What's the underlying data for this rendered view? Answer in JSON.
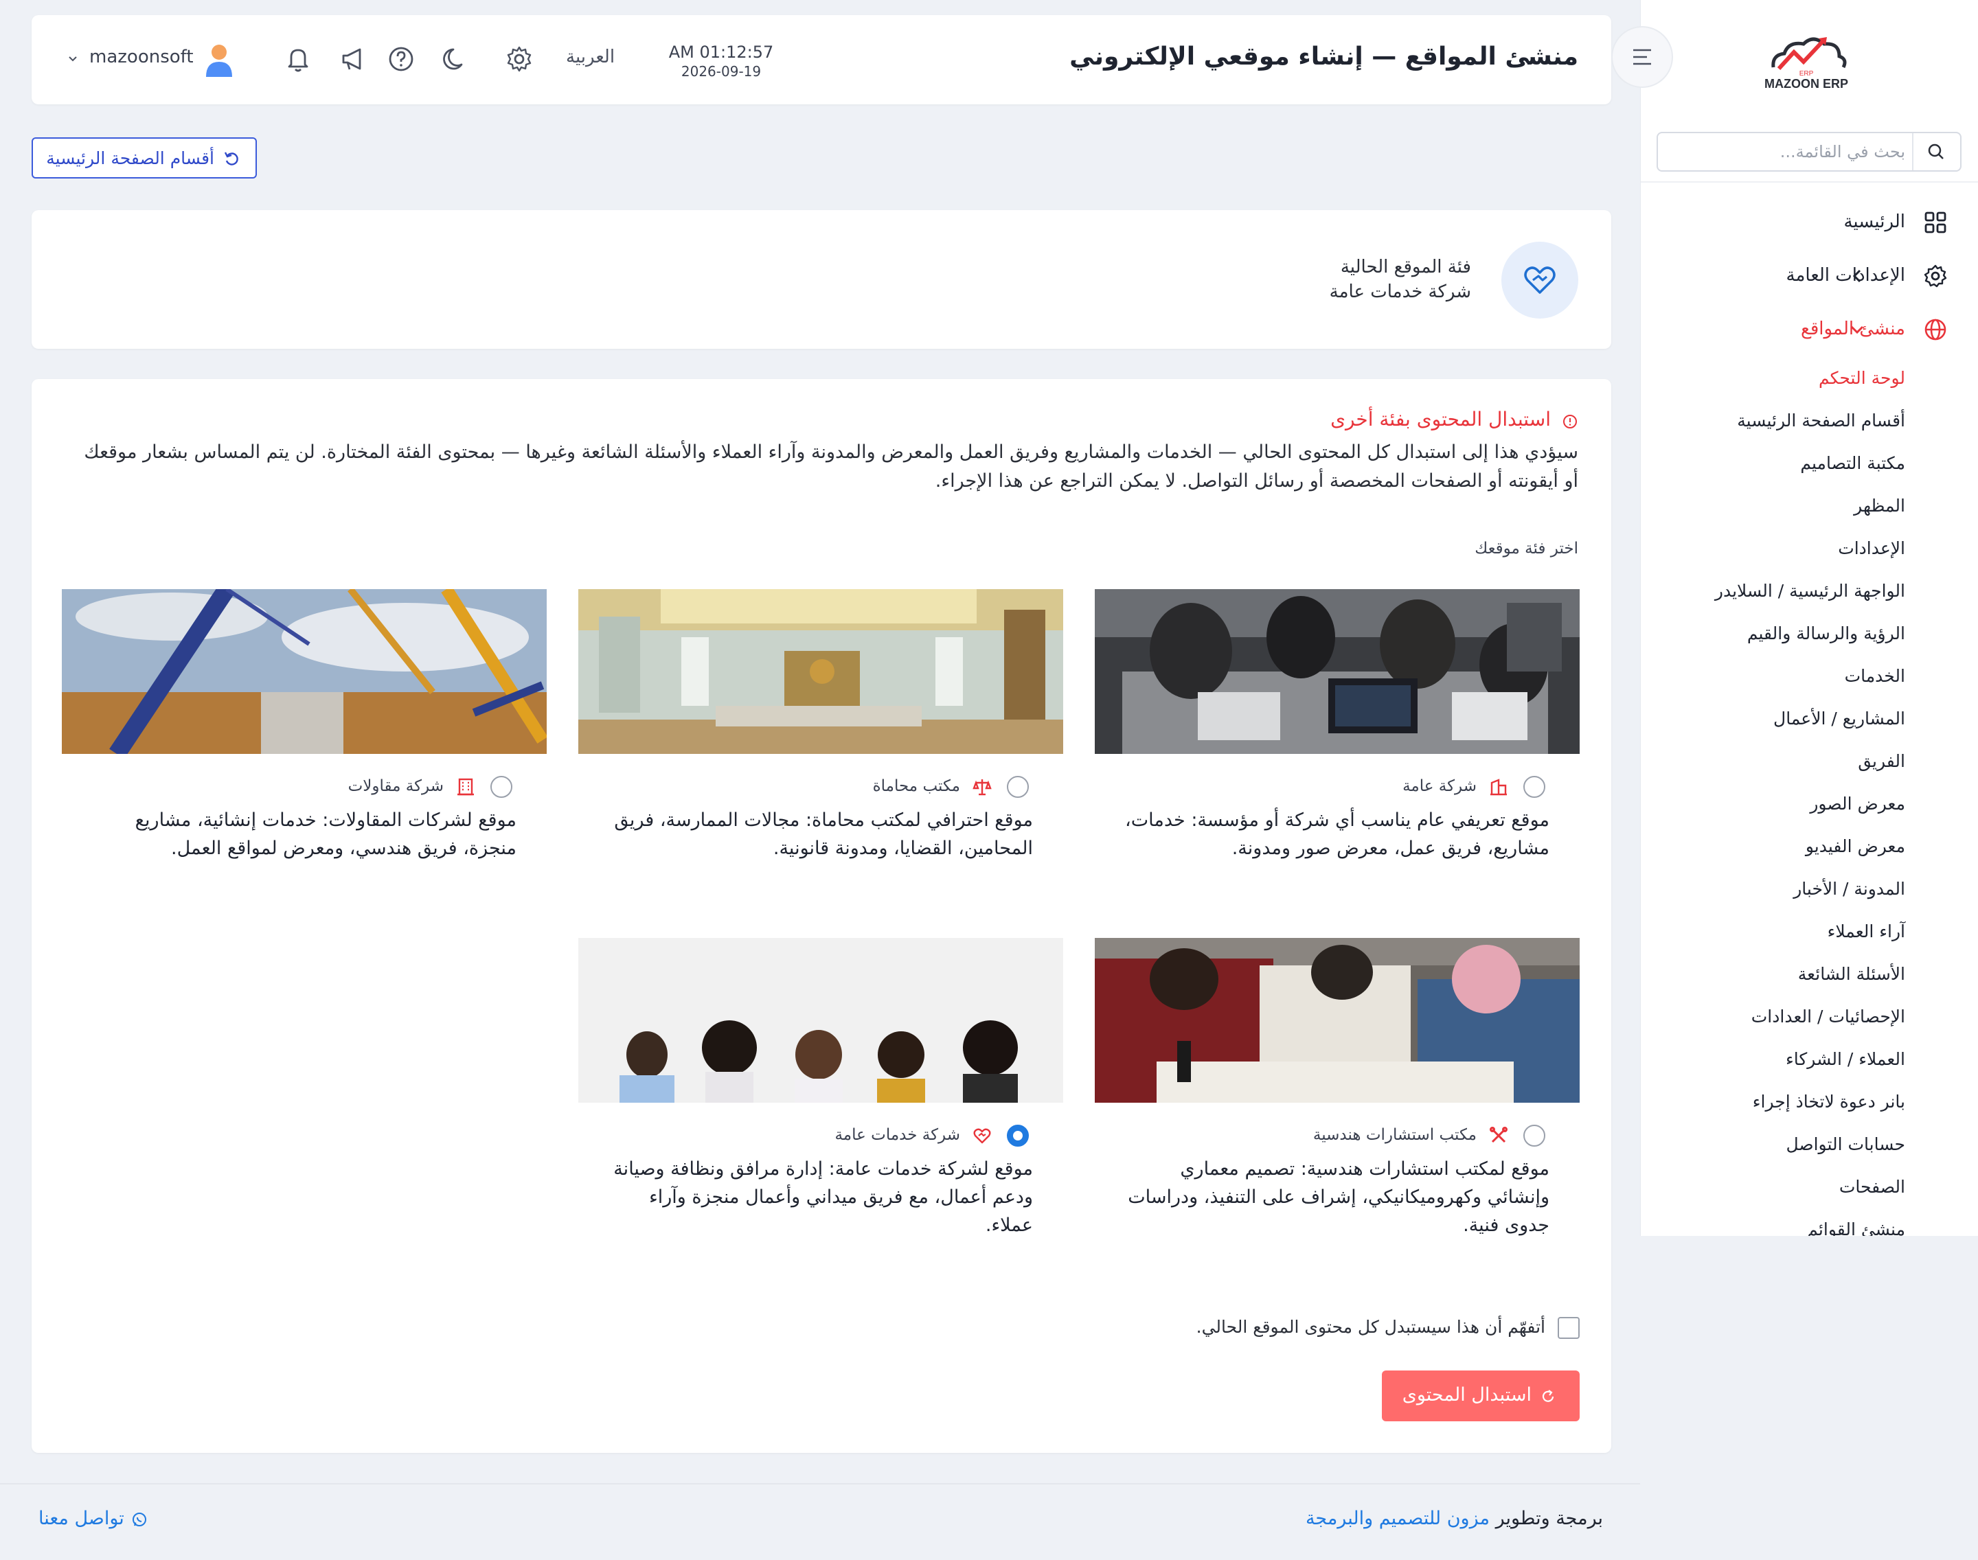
{
  "app": {
    "logo_text": "MAZOON ERP",
    "logo_subtext": "ERP",
    "brand_color": "#e8343a",
    "accent_color": "#1f7ae0"
  },
  "sidebar": {
    "search_placeholder": "بحث في القائمة...",
    "items": [
      {
        "label": "الرئيسية",
        "icon": "grid-icon"
      },
      {
        "label": "الإعدادات العامة",
        "icon": "gear-icon",
        "has_children": true
      },
      {
        "label": "منشئ المواقع",
        "icon": "globe-icon",
        "active": true,
        "expanded": true
      }
    ],
    "sub_items": [
      {
        "label": "لوحة التحكم",
        "active": true
      },
      {
        "label": "أقسام الصفحة الرئيسية"
      },
      {
        "label": "مكتبة التصاميم"
      },
      {
        "label": "المظهر"
      },
      {
        "label": "الإعدادات"
      },
      {
        "label": "الواجهة الرئيسية / السلايدر"
      },
      {
        "label": "الرؤية والرسالة والقيم"
      },
      {
        "label": "الخدمات"
      },
      {
        "label": "المشاريع / الأعمال"
      },
      {
        "label": "الفريق"
      },
      {
        "label": "معرض الصور"
      },
      {
        "label": "معرض الفيديو"
      },
      {
        "label": "المدونة / الأخبار"
      },
      {
        "label": "آراء العملاء"
      },
      {
        "label": "الأسئلة الشائعة"
      },
      {
        "label": "الإحصائيات / العدادات"
      },
      {
        "label": "العملاء / الشركاء"
      },
      {
        "label": "بانر دعوة لاتخاذ إجراء"
      },
      {
        "label": "حسابات التواصل"
      },
      {
        "label": "الصفحات"
      },
      {
        "label": "منشئ القوائم"
      }
    ]
  },
  "header": {
    "title": "منشئ المواقع — إنشاء موقعي الإلكتروني",
    "time": "AM 01:12:57",
    "date": "2026-09-19",
    "language": "العربية",
    "username": "mazoonsoft"
  },
  "sections_button": {
    "label": "أقسام الصفحة الرئيسية"
  },
  "current_category": {
    "label": "فئة الموقع الحالية",
    "value": "شركة خدمات عامة"
  },
  "replace": {
    "warning_title": "استبدال المحتوى بفئة أخرى",
    "warning_text": "سيؤدي هذا إلى استبدال كل المحتوى الحالي — الخدمات والمشاريع وفريق العمل والمعرض والمدونة وآراء العملاء والأسئلة الشائعة وغيرها — بمحتوى الفئة المختارة. لن يتم المساس بشعار موقعك أو أيقونته أو الصفحات المخصصة أو رسائل التواصل. لا يمكن التراجع عن هذا الإجراء.",
    "choose_label": "اختر فئة موقعك",
    "options": [
      {
        "name": "شركة عامة",
        "icon": "building-icon",
        "description": "موقع تعريفي عام يناسب أي شركة أو مؤسسة: خدمات، مشاريع، فريق عمل، معرض صور ومدونة.",
        "selected": false
      },
      {
        "name": "مكتب محاماة",
        "icon": "scales-icon",
        "description": "موقع احترافي لمكتب محاماة: مجالات الممارسة، فريق المحامين، القضايا، ومدونة قانونية.",
        "selected": false
      },
      {
        "name": "شركة مقاولات",
        "icon": "office-building-icon",
        "description": "موقع لشركات المقاولات: خدمات إنشائية، مشاريع منجزة، فريق هندسي، ومعرض لمواقع العمل.",
        "selected": false
      },
      {
        "name": "مكتب استشارات هندسية",
        "icon": "tools-icon",
        "description": "موقع لمكتب استشارات هندسية: تصميم معماري وإنشائي وكهروميكانيكي، إشراف على التنفيذ، ودراسات جدوى فنية.",
        "selected": false
      },
      {
        "name": "شركة خدمات عامة",
        "icon": "heart-hands-icon",
        "description": "موقع لشركة خدمات عامة: إدارة مرافق ونظافة وصيانة ودعم أعمال، مع فريق ميداني وأعمال منجزة وآراء عملاء.",
        "selected": true
      }
    ],
    "confirm_label": "أتفهّم أن هذا سيستبدل كل محتوى الموقع الحالي.",
    "button_label": "استبدال المحتوى"
  },
  "footer": {
    "credit_prefix": "برمجة وتطوير",
    "credit_link": "مزون للتصميم والبرمجة",
    "contact": "تواصل معنا"
  }
}
